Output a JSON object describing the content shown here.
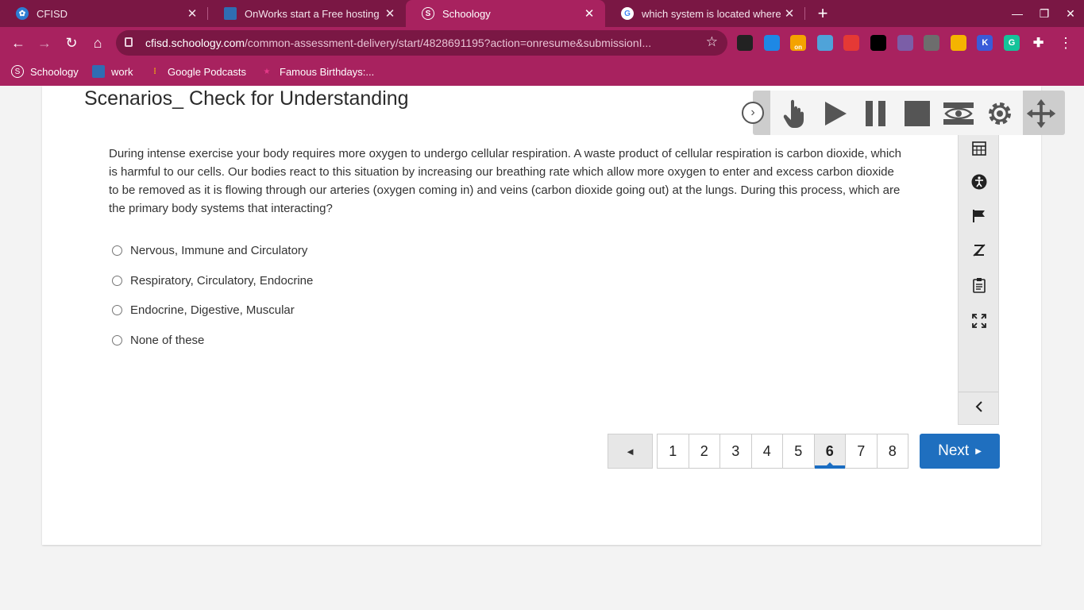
{
  "browser": {
    "tabs": [
      {
        "title": "CFISD",
        "active": false
      },
      {
        "title": "OnWorks start a Free hosting pro",
        "active": false
      },
      {
        "title": "Schoology",
        "active": true
      },
      {
        "title": "which system is located where F",
        "active": false
      }
    ],
    "address": {
      "host": "cfisd.schoology.com",
      "path": "/common-assessment-delivery/start/4828691195?action=onresume&submissionI..."
    },
    "extensions": [
      {
        "name": "user-ext-icon",
        "label": "",
        "color": "#222222"
      },
      {
        "name": "diamond-ext-icon",
        "label": "",
        "color": "#1e88e5"
      },
      {
        "name": "on-ext-icon",
        "label": "on",
        "color": "#f4a300"
      },
      {
        "name": "cloud-ext-icon",
        "label": "",
        "color": "#4fa3d9"
      },
      {
        "name": "color-ext-icon",
        "label": "",
        "color": "#e53935"
      },
      {
        "name": "a-ext-icon",
        "label": "",
        "color": "#000000"
      },
      {
        "name": "pdf-ext-icon",
        "label": "",
        "color": "#7b5ea7"
      },
      {
        "name": "copy-ext-icon",
        "label": "",
        "color": "#6d6d6d"
      },
      {
        "name": "pen-ext-icon",
        "label": "",
        "color": "#f4b400"
      },
      {
        "name": "k-ext-icon",
        "label": "K",
        "color": "#3a5bd9"
      },
      {
        "name": "grammarly-ext-icon",
        "label": "G",
        "color": "#15c39a"
      },
      {
        "name": "puzzle-ext-icon",
        "label": "",
        "color": "#ffffff"
      }
    ],
    "bookmarks": [
      {
        "label": "Schoology"
      },
      {
        "label": "work"
      },
      {
        "label": "Google Podcasts"
      },
      {
        "label": "Famous Birthdays:..."
      }
    ]
  },
  "assessment": {
    "title": "Scenarios_ Check for Understanding",
    "question": "During intense exercise your body requires more oxygen to undergo cellular respiration.  A waste product of cellular respiration is carbon dioxide, which is harmful to our cells.  Our bodies react to this situation by increasing our breathing rate which allow more oxygen to enter and excess carbon dioxide to be removed as it is flowing through our arteries (oxygen coming in) and veins (carbon dioxide going out) at the lungs.  During this process, which are the primary body systems that interacting?",
    "options": [
      "Nervous, Immune and Circulatory",
      "Respiratory, Circulatory, Endocrine",
      "Endocrine, Digestive, Muscular",
      "None of these"
    ],
    "pagination": {
      "prev_label": "◄",
      "pages": [
        "1",
        "2",
        "3",
        "4",
        "5",
        "6",
        "7",
        "8"
      ],
      "current": "6",
      "next_label": "Next"
    }
  },
  "tools": [
    "calculator-icon",
    "accessibility-icon",
    "flag-icon",
    "eliminator-icon",
    "notepad-icon",
    "fullscreen-icon",
    "collapse-left-icon"
  ],
  "colors": {
    "chrome": "#a8225f",
    "chrome_dark": "#7a1744",
    "accent": "#1f6fbf"
  }
}
